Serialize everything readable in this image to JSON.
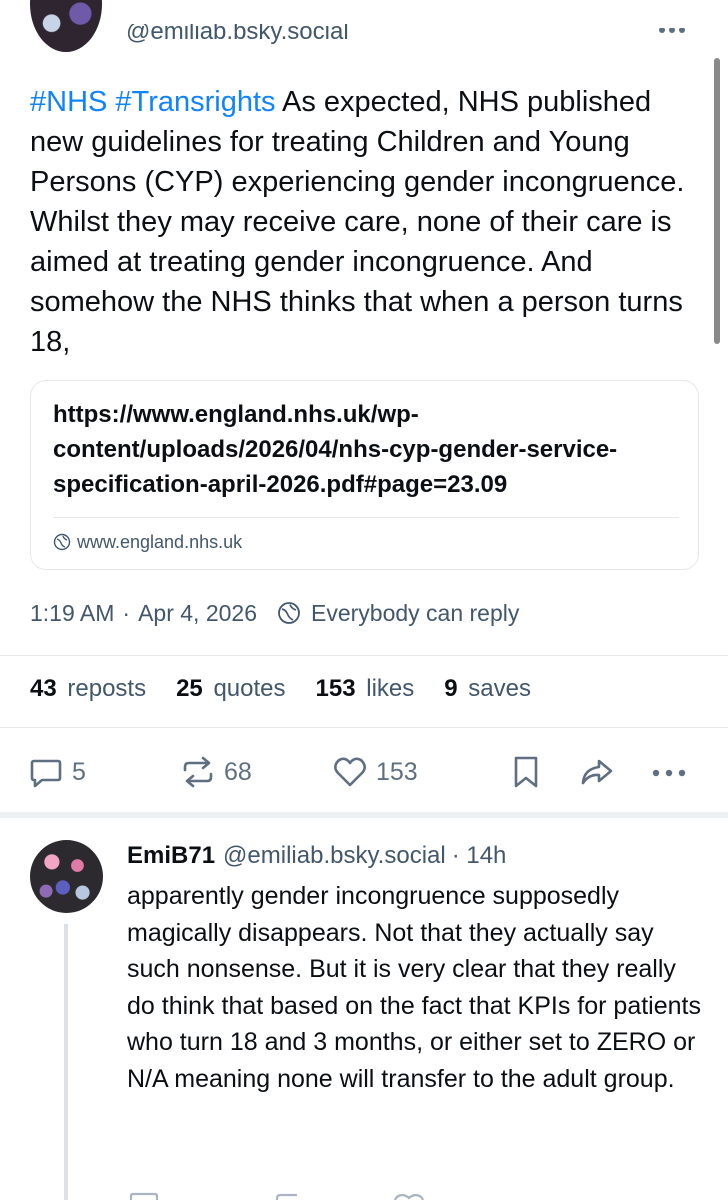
{
  "top_post": {
    "handle": "@emiliab.bsky.social",
    "hashtags": [
      "#NHS",
      "#Transrights"
    ],
    "text": "As expected, NHS published new guidelines for treating Children and Young Persons (CYP) experiencing gender incongruence. Whilst they may receive care, none of their care is aimed at treating gender incongruence. And somehow the NHS thinks that when a person turns 18,",
    "link_card": {
      "url": "https://www.england.nhs.uk/wp-content/uploads/2026/04/nhs-cyp-gender-service-specification-april-2026.pdf#page=23.09",
      "domain": "www.england.nhs.uk"
    },
    "time": "1:19 AM",
    "separator": "·",
    "date": "Apr 4, 2026",
    "reply_setting": "Everybody can reply",
    "stats": {
      "reposts_num": "43",
      "reposts_label": "reposts",
      "quotes_num": "25",
      "quotes_label": "quotes",
      "likes_num": "153",
      "likes_label": "likes",
      "saves_num": "9",
      "saves_label": "saves"
    },
    "actions": {
      "reply_count": "5",
      "repost_count": "68",
      "like_count": "153"
    }
  },
  "reply": {
    "name": "EmiB71",
    "handle": "@emiliab.bsky.social",
    "time": "· 14h",
    "text": "apparently gender incongruence supposedly magically disappears. Not that they actually say such nonsense. But it is very clear that they really do think that based on the fact that KPIs for patients who turn 18 and 3 months, or either set to ZERO or N/A meaning none will transfer to the adult group."
  },
  "colors": {
    "accent": "#1083fe",
    "muted": "#42576c",
    "icon": "#5f6f82",
    "border": "#e4e8ec"
  },
  "icons": [
    "globe-icon",
    "reply-icon",
    "repost-icon",
    "like-icon",
    "bookmark-icon",
    "share-icon",
    "more-icon"
  ]
}
